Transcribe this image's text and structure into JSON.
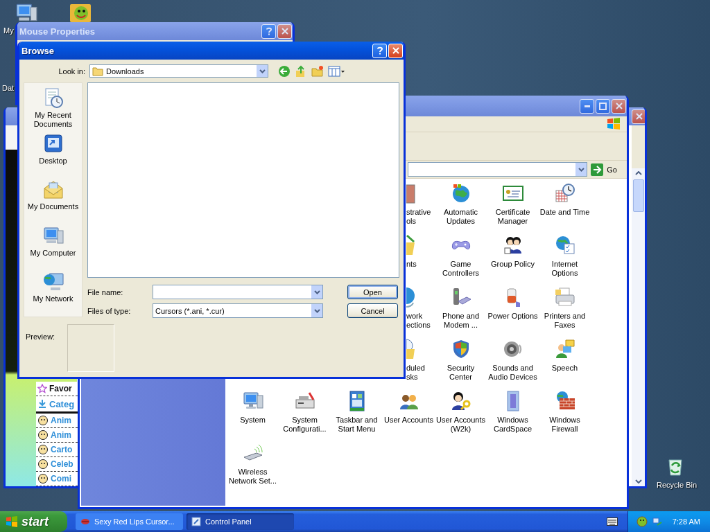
{
  "desktop": {
    "icons": [
      {
        "label": "My"
      },
      {
        "label": "Dat"
      },
      {
        "label": "Recycle Bin"
      }
    ]
  },
  "mouse_properties": {
    "title": "Mouse Properties",
    "active": false
  },
  "browser_window": {
    "active": false,
    "links": [
      {
        "kind": "plain",
        "label": "Favor"
      },
      {
        "kind": "heading",
        "label": "Categ"
      },
      {
        "kind": "link",
        "label": "Anim"
      },
      {
        "kind": "link",
        "label": "Anim"
      },
      {
        "kind": "link",
        "label": "Carto"
      },
      {
        "kind": "link",
        "label": "Celeb"
      },
      {
        "kind": "link",
        "label": "Comi"
      }
    ]
  },
  "control_panel": {
    "active": false,
    "go": "Go",
    "rows": [
      [
        "",
        "",
        "",
        {
          "kind": "partial",
          "label": "strative ols"
        },
        {
          "kind": "full",
          "label": "Automatic Updates"
        },
        {
          "kind": "full",
          "label": "Certificate Manager"
        },
        {
          "kind": "full",
          "label": "Date and Time"
        }
      ],
      [
        "",
        "",
        "",
        {
          "kind": "partial",
          "label": "nts"
        },
        {
          "kind": "full",
          "label": "Game Controllers"
        },
        {
          "kind": "full",
          "label": "Group Policy"
        },
        {
          "kind": "full",
          "label": "Internet Options"
        }
      ],
      [
        "",
        "",
        "",
        {
          "kind": "partial",
          "label": "work ections"
        },
        {
          "kind": "full",
          "label": "Phone and Modem ..."
        },
        {
          "kind": "full",
          "label": "Power Options"
        },
        {
          "kind": "full",
          "label": "Printers and Faxes"
        }
      ],
      [
        "",
        "",
        "",
        {
          "kind": "partial",
          "label": "duled sks"
        },
        {
          "kind": "full",
          "label": "Security Center"
        },
        {
          "kind": "full",
          "label": "Sounds and Audio Devices"
        },
        {
          "kind": "full",
          "label": "Speech"
        }
      ],
      [
        {
          "kind": "full",
          "label": "System"
        },
        {
          "kind": "full",
          "label": "System Configurati..."
        },
        {
          "kind": "full",
          "label": "Taskbar and Start Menu"
        },
        {
          "kind": "full",
          "label": "User Accounts"
        },
        {
          "kind": "full",
          "label": "User Accounts (W2k)"
        },
        {
          "kind": "full",
          "label": "Windows CardSpace"
        },
        {
          "kind": "full",
          "label": "Windows Firewall"
        }
      ],
      [
        {
          "kind": "full",
          "label": "Wireless Network Set..."
        }
      ]
    ]
  },
  "browse": {
    "title": "Browse",
    "active": true,
    "look_in_label": "Look in:",
    "look_in_value": "Downloads",
    "places": [
      {
        "label": "My Recent Documents"
      },
      {
        "label": "Desktop"
      },
      {
        "label": "My Documents"
      },
      {
        "label": "My Computer"
      },
      {
        "label": "My Network"
      }
    ],
    "file_name_label": "File name:",
    "files_of_type_label": "Files of type:",
    "files_of_type_value": "Cursors (*.ani, *.cur)",
    "buttons": [
      {
        "label": "Open",
        "default": true
      },
      {
        "label": "Cancel",
        "default": false
      }
    ],
    "preview_label": "Preview:"
  },
  "taskbar": {
    "start": "start",
    "tasks": [
      {
        "label": "Sexy Red Lips Cursor...",
        "selected": false
      },
      {
        "label": "Control Panel",
        "selected": true
      }
    ],
    "clock": "7:28 AM"
  }
}
